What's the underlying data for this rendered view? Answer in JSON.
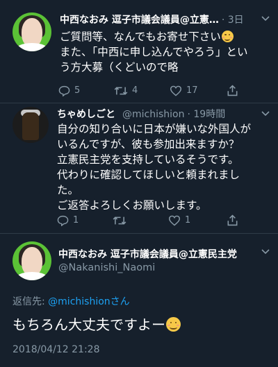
{
  "tweet1": {
    "name": "中西なおみ 逗子市議会議員@立憲…",
    "time": "· 3日",
    "lines": [
      "ご質問等、なんでもお寄せ下さい",
      "また、「中西に申し込んでやろう」とい",
      "う方大募（くどいので略"
    ],
    "emoji": "smiling-face-icon",
    "replies": "5",
    "retweets": "4",
    "likes": "17"
  },
  "tweet2": {
    "name": "ちゃめしごと",
    "handle": "@michishion",
    "time": "· 19時間",
    "lines": [
      "自分の知り合いに日本が嫌いな外国人が",
      "いるんですが、彼も参加出来ますか？",
      "立憲民主党を支持しているそうです。",
      "代わりに確認してほしいと頼まれまし",
      "た。",
      "ご返答よろしくお願いします。"
    ],
    "replies": "1",
    "retweets": "",
    "likes": "1"
  },
  "main_tweet": {
    "name": "中西なおみ 逗子市議会議員@立憲民主党",
    "handle": "@Nakanishi_Naomi",
    "replying_label": "返信先:",
    "replying_handle": "@michishionさん",
    "text": "もちろん大丈夫ですよー",
    "emoji": "smiling-face-icon",
    "timestamp": "2018/04/12 21:28"
  },
  "colors": {
    "background": "#16202c",
    "secondary_text": "#8899a6",
    "link": "#1da1f2"
  }
}
